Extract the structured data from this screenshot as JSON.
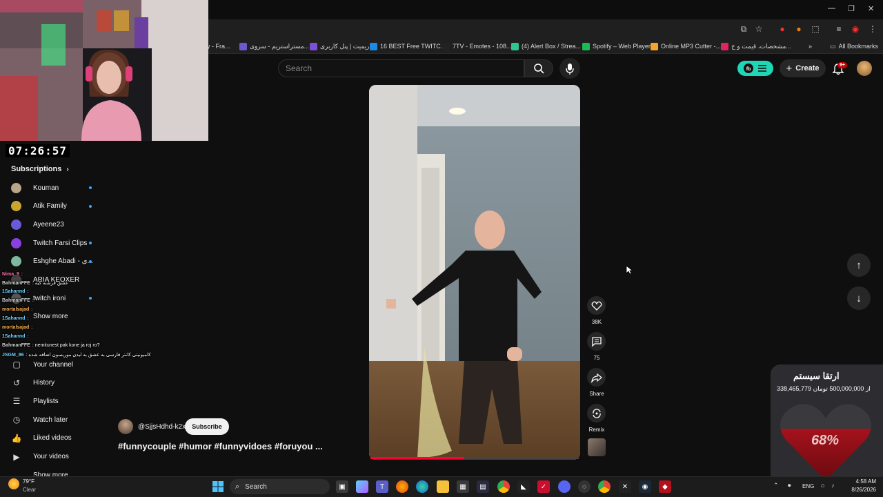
{
  "browser": {
    "bookmarks": [
      {
        "label": "y - Fra...",
        "color": "#ffffff"
      },
      {
        "label": "مستراستریم - سروی...",
        "color": "#6a5acd"
      },
      {
        "label": "ریمیت | پنل کاربری",
        "color": "#7b4fd6"
      },
      {
        "label": "16 BEST Free TWITC...",
        "color": "#1e88e5"
      },
      {
        "label": "7TV - Emotes - 108...",
        "color": "#222222"
      },
      {
        "label": "(4) Alert Box / Strea...",
        "color": "#31c48d"
      },
      {
        "label": "Spotify – Web Player",
        "color": "#1db954"
      },
      {
        "label": "Online MP3 Cutter -...",
        "color": "#f4a62a"
      },
      {
        "label": "مشخصات، قیمت و خ...",
        "color": "#e0245e"
      }
    ],
    "all_bookmarks": "All Bookmarks"
  },
  "header": {
    "search_placeholder": "Search",
    "create_label": "Create",
    "notif_count": "9+"
  },
  "sidebar": {
    "subscriptions_title": "Subscriptions",
    "subscriptions": [
      {
        "name": "Kouman",
        "color": "#b8a58a",
        "dot": true
      },
      {
        "name": "Atik Family",
        "color": "#c9a530",
        "dot": true
      },
      {
        "name": "Ayeene23",
        "color": "#6b5ad6",
        "dot": false
      },
      {
        "name": "Twitch Farsi Clips",
        "color": "#8a3fe0",
        "dot": true
      },
      {
        "name": "Eshghe Abadi - ی...",
        "color": "#7fb89e",
        "dot": true
      },
      {
        "name": "ARIA KEOXER",
        "color": "#444444",
        "dot": false
      },
      {
        "name": "twitch ironi",
        "color": "#555555",
        "dot": true
      }
    ],
    "show_more": "Show more",
    "nav": [
      {
        "label": "Your channel",
        "icon": "user-icon"
      },
      {
        "label": "History",
        "icon": "history-icon"
      },
      {
        "label": "Playlists",
        "icon": "playlist-icon"
      },
      {
        "label": "Watch later",
        "icon": "clock-icon"
      },
      {
        "label": "Liked videos",
        "icon": "thumb-up-icon"
      },
      {
        "label": "Your videos",
        "icon": "video-icon"
      },
      {
        "label": "Show more"
      }
    ]
  },
  "stream_overlay": {
    "timer": "07:26:57",
    "chat": [
      {
        "user": "Nima_9",
        "text": ":",
        "color": "#ff6fa8"
      },
      {
        "user": "BahmanFFE",
        "text": ": عشق فرشته کیه",
        "color": "#cfcfcf"
      },
      {
        "user": "1Sahannd",
        "text": ":",
        "color": "#6fd3ff"
      },
      {
        "user": "BahmanFFE",
        "text": ":",
        "color": "#cfcfcf"
      },
      {
        "user": "mortalsajad",
        "text": ":",
        "color": "#ffb347"
      },
      {
        "user": "1Sahannd",
        "text": ":",
        "color": "#6fd3ff"
      },
      {
        "user": "mortalsajad",
        "text": ":",
        "color": "#ffb347"
      },
      {
        "user": "1Sahannd",
        "text": ":",
        "color": "#6fd3ff"
      },
      {
        "user": "BahmanFFE",
        "text": ": nemitunest pak kone ja roj ro?",
        "color": "#cfcfcf"
      },
      {
        "user": "JSGM_86",
        "text": ": کامیونیتی کانتر فارسی به عشق به لیدن موریسون اضافه شده",
        "color": "#6fd3ff"
      }
    ]
  },
  "short": {
    "channel": "@SjjsHdhd-k2x",
    "subscribe": "Subscribe",
    "title": "#funnycouple #humor #funnyvidoes #foruyou ...",
    "likes": "38K",
    "comments": "75",
    "share": "Share",
    "remix": "Remix",
    "progress": 0.45
  },
  "donation": {
    "title": "ارتقا سیستم",
    "amount_text": "338,465,779 از 500,000,000 تومان",
    "percent": "68%"
  },
  "taskbar": {
    "temp": "79°F",
    "weather": "Clear",
    "search": "Search",
    "lang": "ENG",
    "time": "4:58 AM",
    "date": "8/26/2026"
  }
}
